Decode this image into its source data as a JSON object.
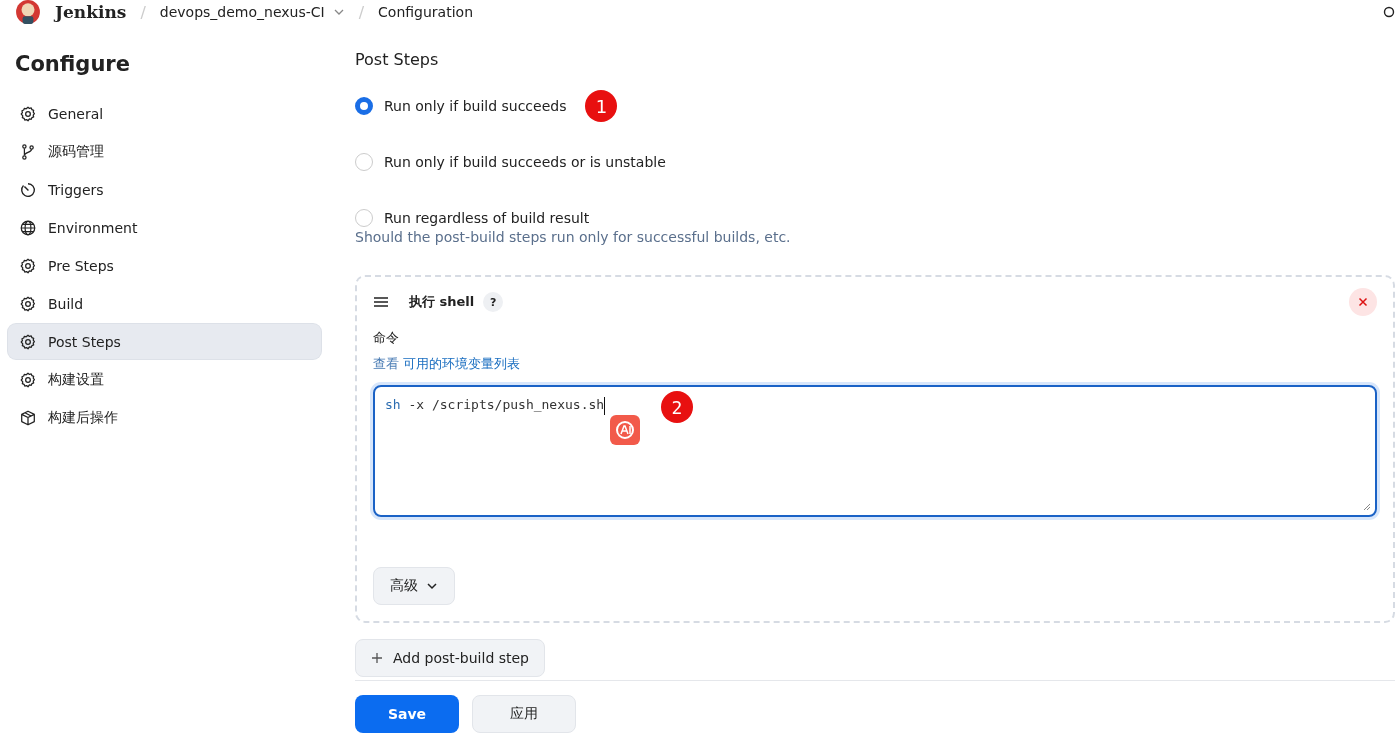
{
  "header": {
    "logo": "Jenkins",
    "breadcrumbs": [
      {
        "separator": "/",
        "label": "devops_demo_nexus-CI",
        "dropdown": true
      },
      {
        "separator": "/",
        "label": "Configuration",
        "dropdown": false
      }
    ]
  },
  "sidebar": {
    "title": "Configure",
    "items": [
      {
        "label": "General",
        "selected": false
      },
      {
        "label": "源码管理",
        "selected": false
      },
      {
        "label": "Triggers",
        "selected": false
      },
      {
        "label": "Environment",
        "selected": false
      },
      {
        "label": "Pre Steps",
        "selected": false
      },
      {
        "label": "Build",
        "selected": false
      },
      {
        "label": "Post Steps",
        "selected": true
      },
      {
        "label": "构建设置",
        "selected": false
      },
      {
        "label": "构建后操作",
        "selected": false
      }
    ]
  },
  "section": {
    "title": "Post Steps",
    "options": [
      {
        "label": "Run only if build succeeds",
        "selected": true,
        "marker": "1"
      },
      {
        "label": "Run only if build succeeds or is unstable",
        "selected": false
      },
      {
        "label": "Run regardless of build result",
        "selected": false
      }
    ],
    "hint": "Should the post-build steps run only for successful builds, etc."
  },
  "step": {
    "title": "执行 shell",
    "help": "?",
    "field_label": "命令",
    "env_prefix": "查看",
    "env_link": "可用的环境变量列表",
    "command": "sh -x /scripts/push_nexus.sh",
    "marker": "2",
    "advanced": "高级"
  },
  "add_button": "Add post-build step",
  "buttons": [
    "Save",
    "应用"
  ]
}
